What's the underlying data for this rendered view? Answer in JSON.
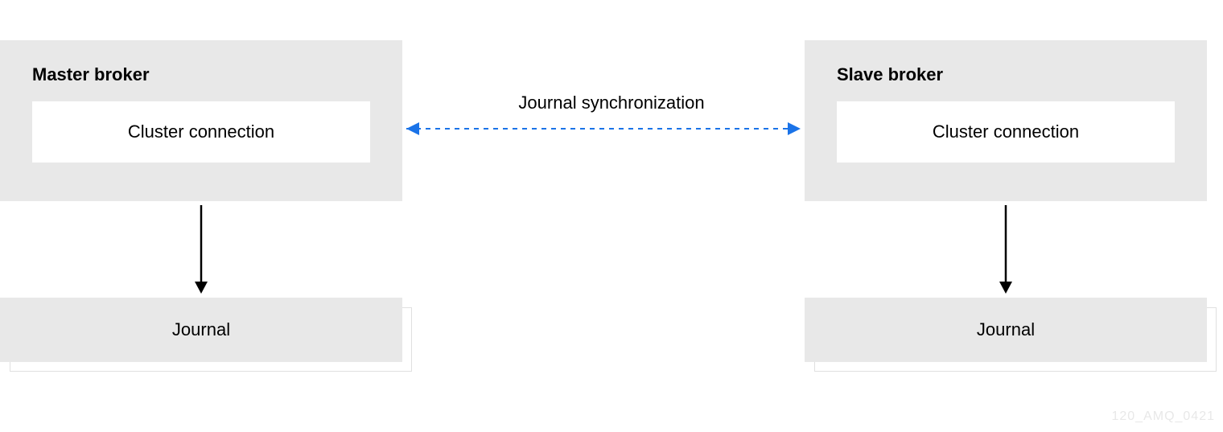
{
  "master": {
    "title": "Master broker",
    "cluster_label": "Cluster connection",
    "journal_label": "Journal"
  },
  "slave": {
    "title": "Slave broker",
    "cluster_label": "Cluster connection",
    "journal_label": "Journal"
  },
  "sync_label": "Journal synchronization",
  "watermark": "120_AMQ_0421",
  "colors": {
    "box_bg": "#e8e8e8",
    "sync_line": "#1a73e8",
    "arrow": "#000000"
  }
}
